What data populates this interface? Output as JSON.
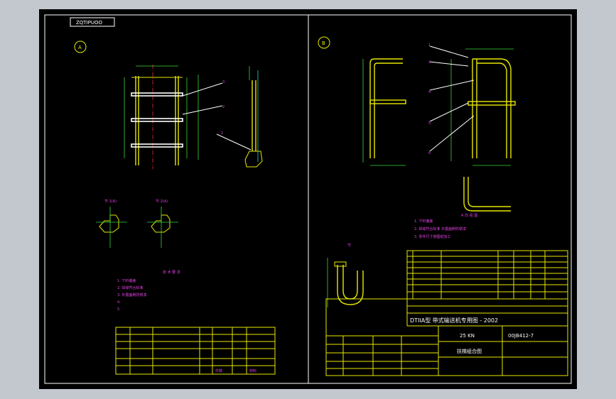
{
  "drawing": {
    "stamp_top_left": "ZQTIPUOO",
    "view_a_label": "A",
    "view_b_label": "B",
    "title_block_right": {
      "standard_line": "DTIIA型 带式输送机专用图 - 2002",
      "capacity": "25 KN",
      "drawing_no": "00JB412-7",
      "name": "扶梯组合图"
    },
    "title_block_left": {
      "qty_label": "件数",
      "material_label": "材料"
    }
  },
  "colors": {
    "background": "#000000",
    "frame": "#ffffff",
    "outline": "#e8e800",
    "dimension": "#3ad63a",
    "annotation": "#e040e0",
    "centerline": "#e03030"
  }
}
